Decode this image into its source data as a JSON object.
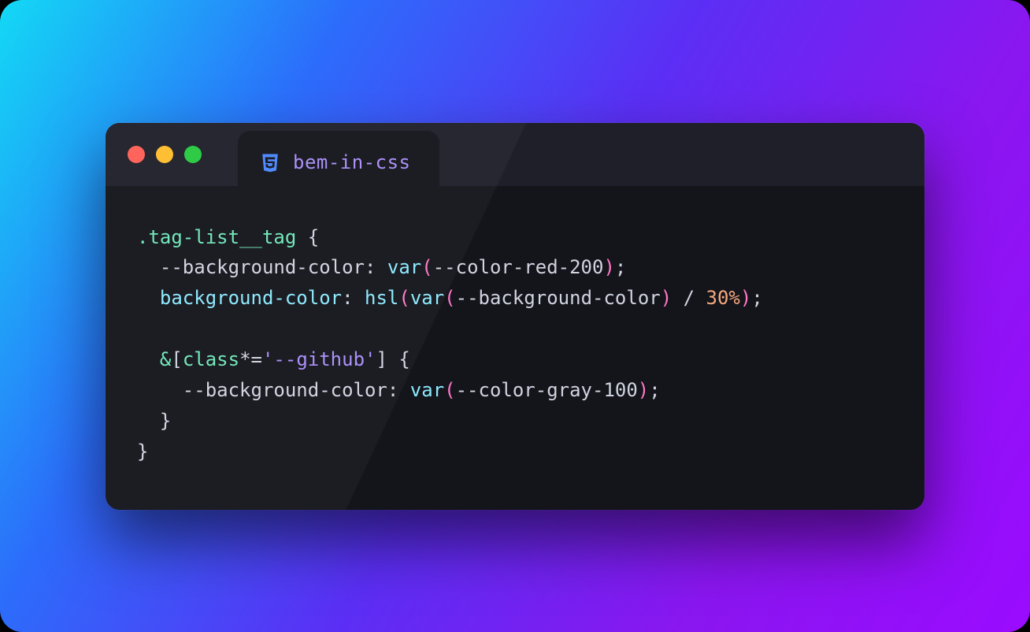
{
  "window": {
    "tab_label": "bem-in-css",
    "traffic_colors": {
      "close": "#ff5f56",
      "minimize": "#ffbd2e",
      "maximize": "#27c93f"
    }
  },
  "colors": {
    "selector": "#6ee7b7",
    "punct": "#d0d4e0",
    "prop_custom": "#d0d4e0",
    "prop": "#8be9fd",
    "func": "#8be9fd",
    "number": "#f5a97f",
    "paren": "#ff79c6",
    "string": "#a98ef9",
    "tab_label": "#a98ef9",
    "icon": "#4a88ff",
    "bg_window": "#14141b",
    "bg_titlebar": "#1e1f29"
  },
  "code": {
    "lines": [
      {
        "indent": 0,
        "tokens": [
          {
            "t": ".tag-list__tag",
            "c": "selector"
          },
          {
            "t": " {",
            "c": "punct"
          }
        ]
      },
      {
        "indent": 1,
        "tokens": [
          {
            "t": "--background-color",
            "c": "prop_custom"
          },
          {
            "t": ": ",
            "c": "punct"
          },
          {
            "t": "var",
            "c": "func"
          },
          {
            "t": "(",
            "c": "paren"
          },
          {
            "t": "--color-red-200",
            "c": "prop_custom"
          },
          {
            "t": ")",
            "c": "paren"
          },
          {
            "t": ";",
            "c": "punct"
          }
        ]
      },
      {
        "indent": 1,
        "tokens": [
          {
            "t": "background-color",
            "c": "prop"
          },
          {
            "t": ": ",
            "c": "punct"
          },
          {
            "t": "hsl",
            "c": "func"
          },
          {
            "t": "(",
            "c": "paren"
          },
          {
            "t": "var",
            "c": "func"
          },
          {
            "t": "(",
            "c": "paren"
          },
          {
            "t": "--background-color",
            "c": "prop_custom"
          },
          {
            "t": ")",
            "c": "paren"
          },
          {
            "t": " / ",
            "c": "punct"
          },
          {
            "t": "30%",
            "c": "number"
          },
          {
            "t": ")",
            "c": "paren"
          },
          {
            "t": ";",
            "c": "punct"
          }
        ]
      },
      {
        "indent": 0,
        "tokens": []
      },
      {
        "indent": 1,
        "tokens": [
          {
            "t": "&",
            "c": "selector"
          },
          {
            "t": "[",
            "c": "punct"
          },
          {
            "t": "class",
            "c": "selector"
          },
          {
            "t": "*=",
            "c": "punct"
          },
          {
            "t": "'--github'",
            "c": "string"
          },
          {
            "t": "]",
            "c": "punct"
          },
          {
            "t": " {",
            "c": "punct"
          }
        ]
      },
      {
        "indent": 2,
        "tokens": [
          {
            "t": "--background-color",
            "c": "prop_custom"
          },
          {
            "t": ": ",
            "c": "punct"
          },
          {
            "t": "var",
            "c": "func"
          },
          {
            "t": "(",
            "c": "paren"
          },
          {
            "t": "--color-gray-100",
            "c": "prop_custom"
          },
          {
            "t": ")",
            "c": "paren"
          },
          {
            "t": ";",
            "c": "punct"
          }
        ]
      },
      {
        "indent": 1,
        "tokens": [
          {
            "t": "}",
            "c": "punct"
          }
        ]
      },
      {
        "indent": 0,
        "tokens": [
          {
            "t": "}",
            "c": "punct"
          }
        ]
      }
    ]
  }
}
